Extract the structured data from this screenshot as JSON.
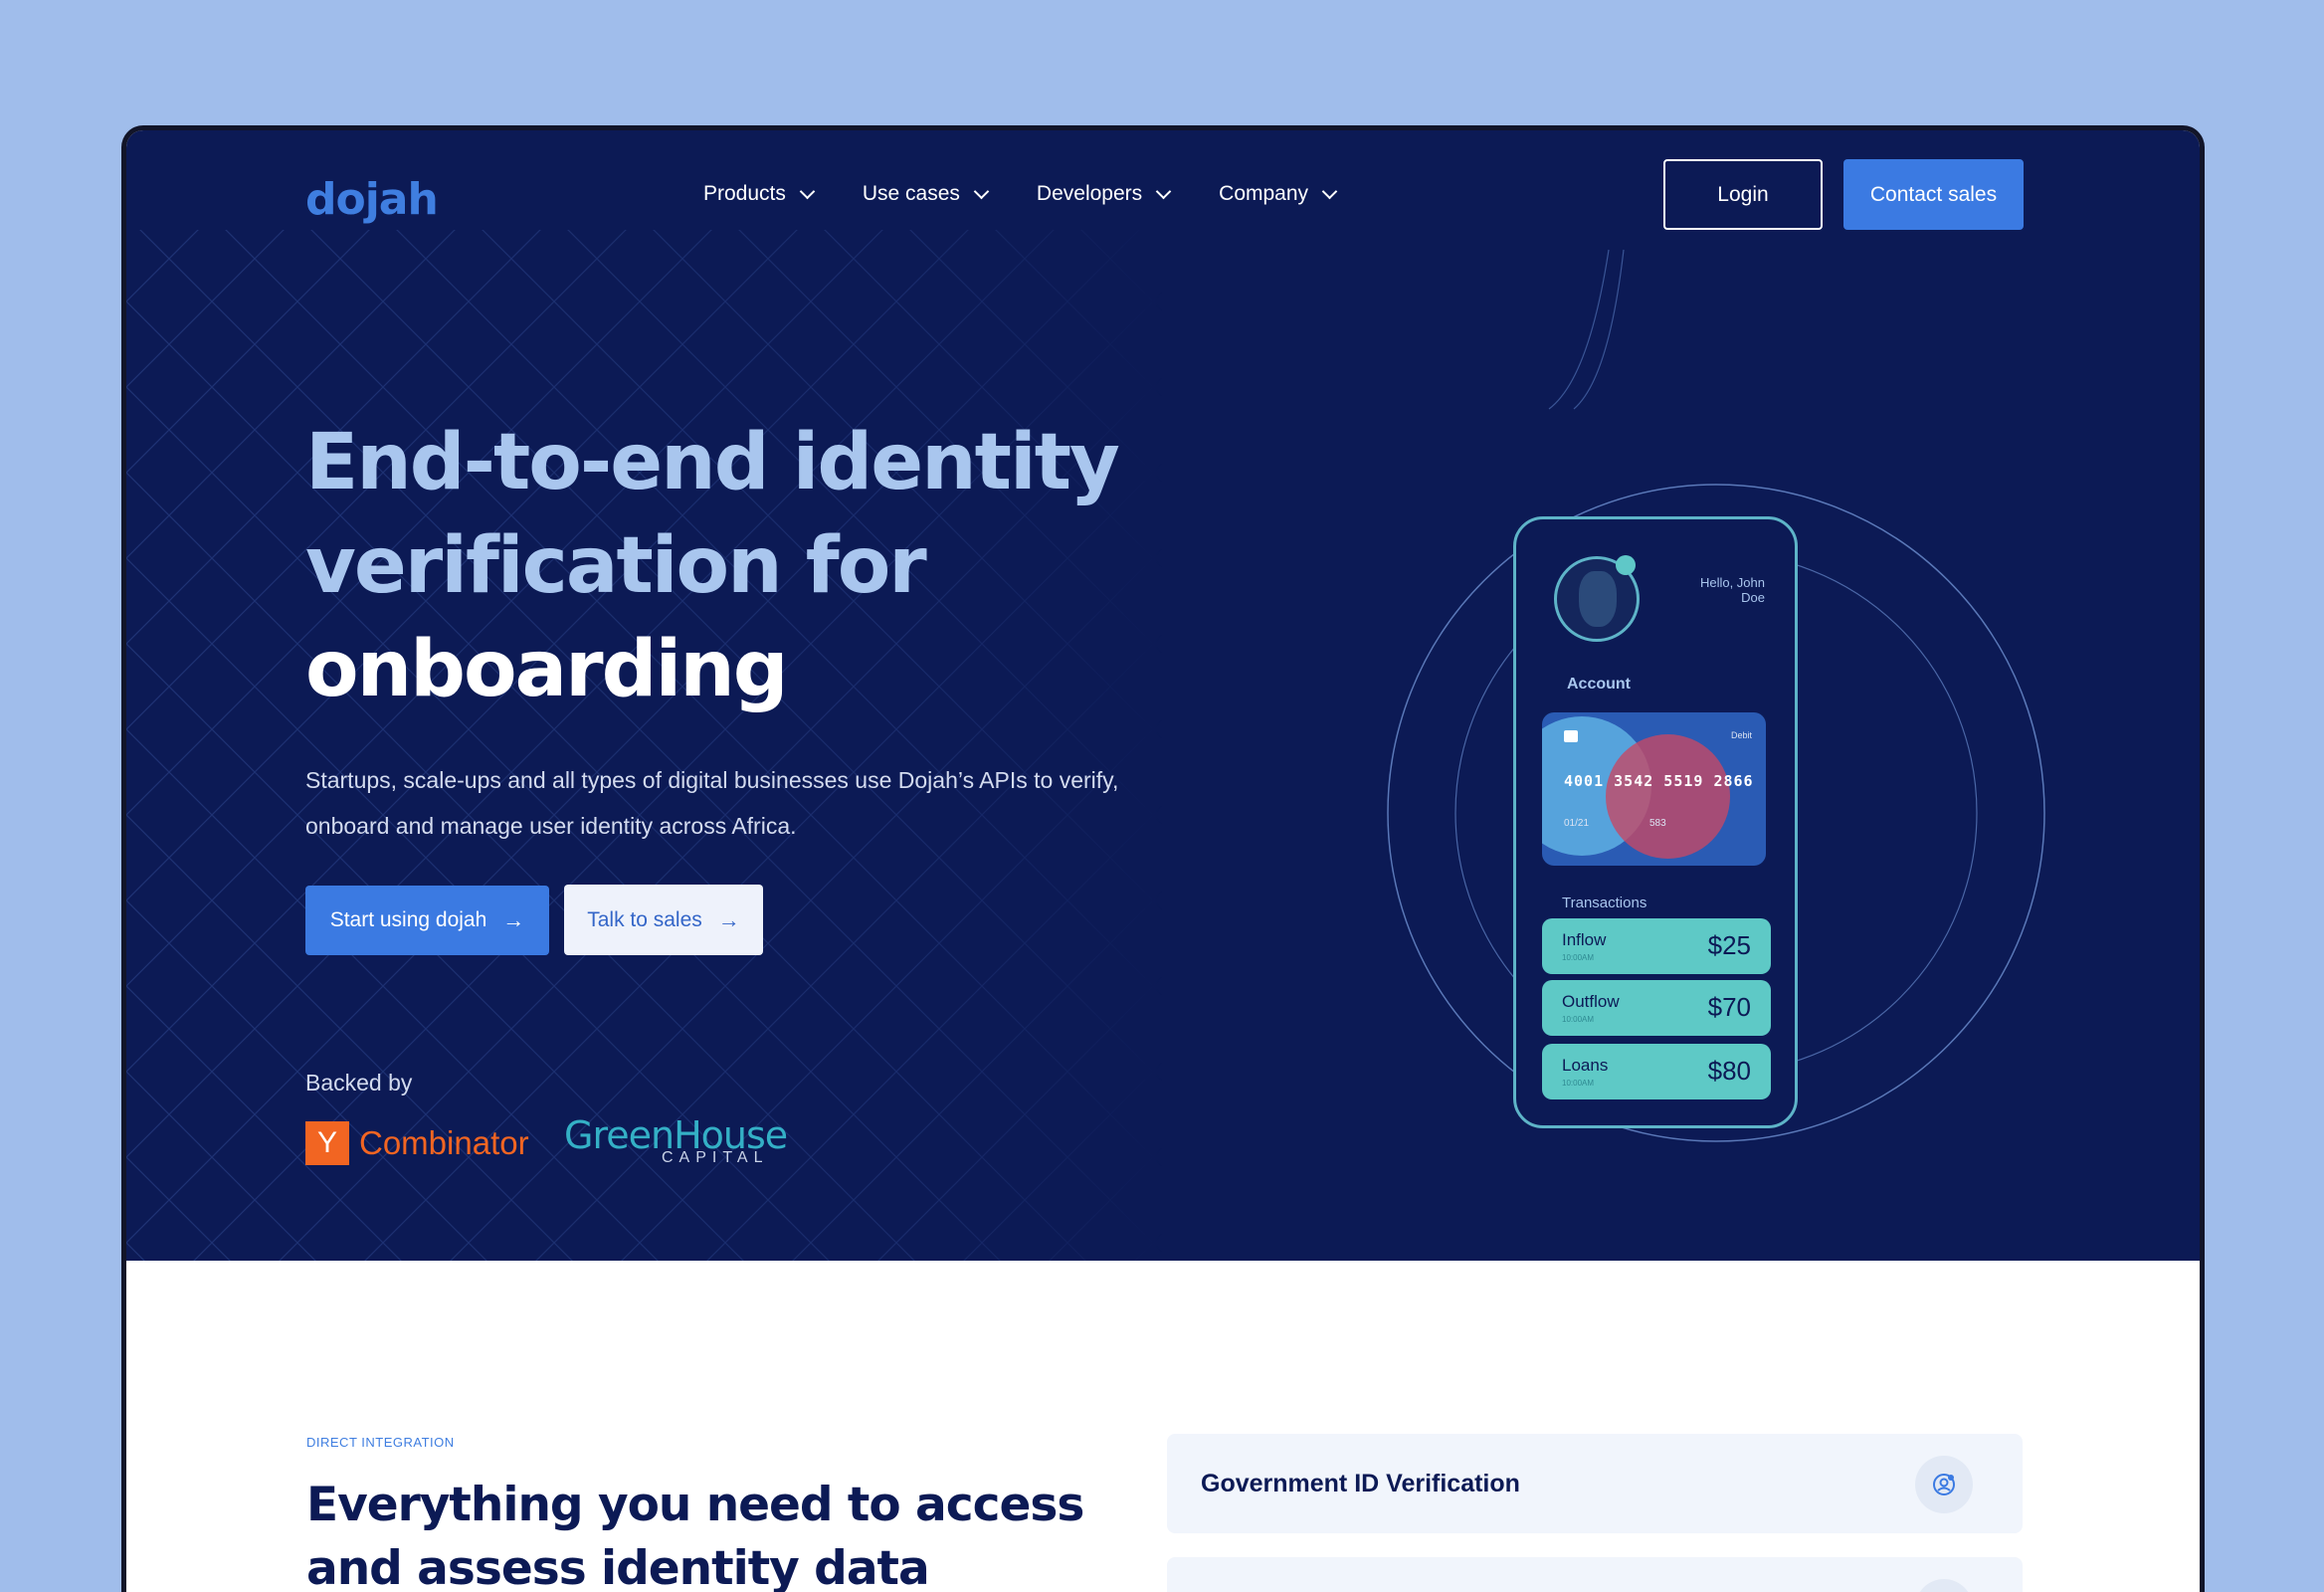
{
  "brand": {
    "logo_text": "dojah",
    "accent": "#3b7ae2",
    "hero_bg": "#0c1a55"
  },
  "nav": {
    "items": [
      {
        "label": "Products"
      },
      {
        "label": "Use cases"
      },
      {
        "label": "Developers"
      },
      {
        "label": "Company"
      }
    ],
    "login_label": "Login",
    "contact_label": "Contact sales"
  },
  "hero": {
    "headline_line1": "End-to-end identity",
    "headline_line2": "verification for",
    "headline_line3": "onboarding",
    "subcopy": "Startups, scale-ups and all types of digital businesses use Dojah’s APIs to verify, onboard and manage user identity across Africa.",
    "cta_primary": "Start using dojah",
    "cta_secondary": "Talk to sales",
    "backed_by": "Backed by",
    "backers": {
      "yc_letter": "Y",
      "yc_name": "Combinator",
      "gh_main": "GreenHouse",
      "gh_sub": "CAPITAL"
    }
  },
  "phone": {
    "greeting": "Hello, John Doe",
    "account_label": "Account",
    "card": {
      "type": "Debit",
      "number": "4001 3542 5519 2866",
      "expiry": "01/21",
      "cvv": "583"
    },
    "transactions_label": "Transactions",
    "transactions": [
      {
        "label": "Inflow",
        "time": "10:00AM",
        "amount": "$25"
      },
      {
        "label": "Outflow",
        "time": "10:00AM",
        "amount": "$70"
      },
      {
        "label": "Loans",
        "time": "10:00AM",
        "amount": "$80"
      }
    ]
  },
  "section": {
    "eyebrow": "DIRECT INTEGRATION",
    "title": "Everything you need to access and assess identity data",
    "features": [
      {
        "title": "Government ID Verification",
        "icon": "user-check-icon"
      },
      {
        "title": "",
        "icon": "feature-icon"
      }
    ]
  }
}
